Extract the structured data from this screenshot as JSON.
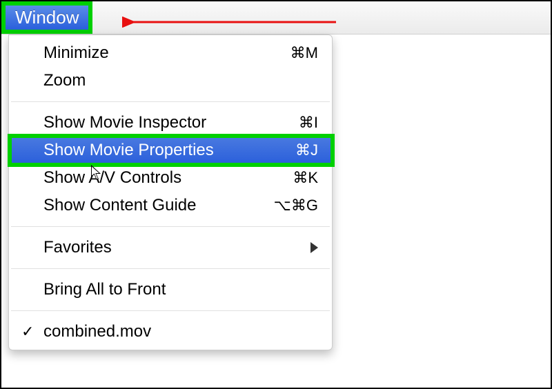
{
  "menubar": {
    "title": "Window"
  },
  "menu": {
    "items": [
      {
        "label": "Minimize",
        "shortcut": "⌘M"
      },
      {
        "label": "Zoom",
        "shortcut": ""
      },
      {
        "label": "Show Movie Inspector",
        "shortcut": "⌘I"
      },
      {
        "label": "Show Movie Properties",
        "shortcut": "⌘J"
      },
      {
        "label": "Show A/V Controls",
        "shortcut": "⌘K"
      },
      {
        "label": "Show Content Guide",
        "shortcut": "⌥⌘G"
      },
      {
        "label": "Favorites",
        "shortcut": ""
      },
      {
        "label": "Bring All to Front",
        "shortcut": ""
      },
      {
        "label": "combined.mov",
        "shortcut": ""
      }
    ]
  }
}
